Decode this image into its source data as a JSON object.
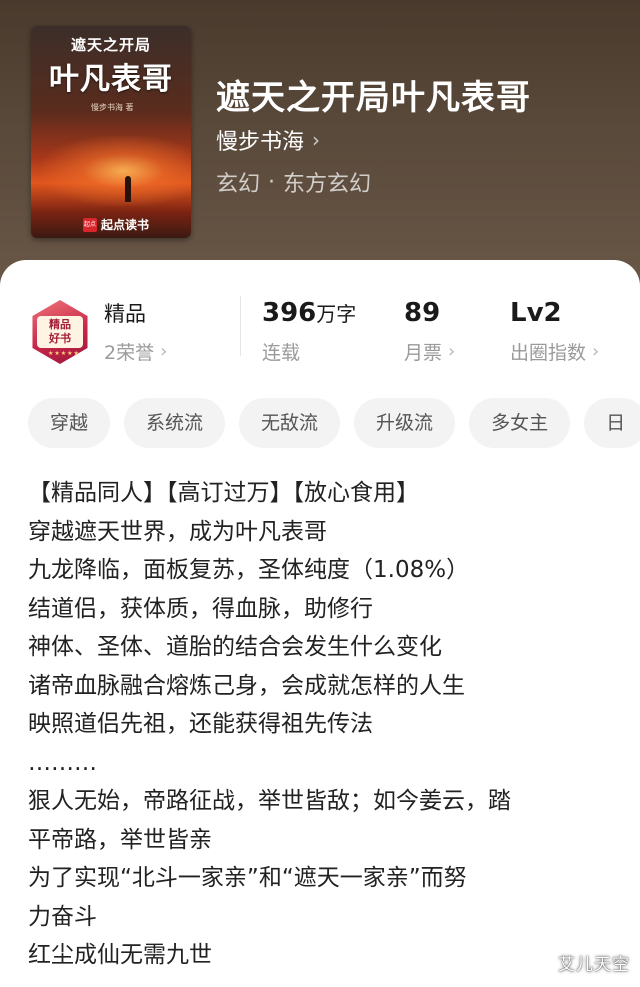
{
  "book": {
    "cover": {
      "title_small": "遮天之开局",
      "title_big": "叶凡表哥",
      "author_small": "慢步书海 著",
      "brand_badge": "起点",
      "brand_text": "起点读书"
    },
    "title": "遮天之开局叶凡表哥",
    "author": "慢步书海",
    "genre": "玄幻",
    "separator": "·",
    "subgenre": "东方玄幻"
  },
  "stats": {
    "premium": {
      "label": "精品",
      "honor": "2荣誉",
      "badge_text_line1": "精品",
      "badge_text_line2": "好书"
    },
    "words": {
      "value": "396",
      "unit": "万字",
      "status": "连载"
    },
    "monthly_ticket": {
      "value": "89",
      "label": "月票"
    },
    "breakout": {
      "value": "Lv2",
      "label": "出圈指数"
    }
  },
  "tags": [
    "穿越",
    "系统流",
    "无敌流",
    "升级流",
    "多女主",
    "日"
  ],
  "description": [
    "【精品同人】【高订过万】【放心食用】",
    "穿越遮天世界，成为叶凡表哥",
    "九龙降临，面板复苏，圣体纯度（1.08%）",
    "结道侣，获体质，得血脉，助修行",
    "神体、圣体、道胎的结合会发生什么变化",
    "诸帝血脉融合熔炼己身，会成就怎样的人生",
    "映照道侣先祖，还能获得祖先传法",
    "………",
    "狠人无始，帝路征战，举世皆敌；如今姜云，踏",
    "平帝路，举世皆亲",
    "为了实现“北斗一家亲”和“遮天一家亲”而努",
    "力奋斗",
    "红尘成仙无需九世"
  ],
  "watermark": "艾儿天空",
  "icons": {
    "chevron": "chevron-right-icon"
  }
}
